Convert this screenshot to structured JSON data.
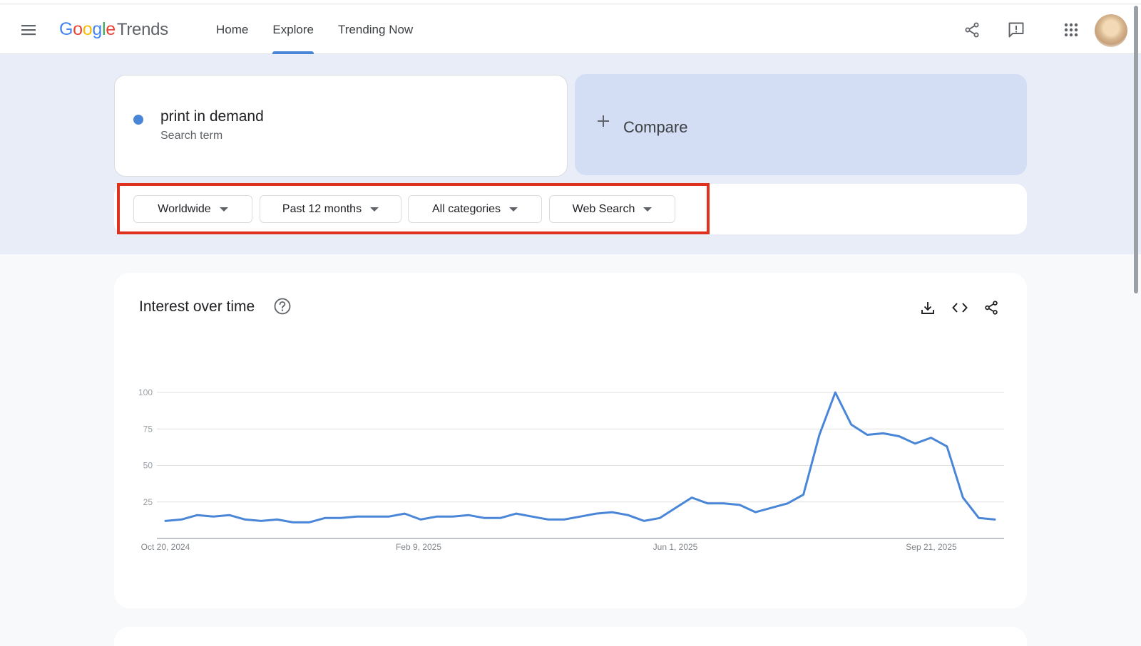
{
  "header": {
    "logo": {
      "g1": "G",
      "o1": "o",
      "o2": "o",
      "g2": "g",
      "l": "l",
      "e": "e",
      "suffix": "Trends"
    },
    "nav": [
      {
        "label": "Home",
        "active": false
      },
      {
        "label": "Explore",
        "active": true
      },
      {
        "label": "Trending Now",
        "active": false
      }
    ],
    "icons": [
      "share-icon",
      "feedback-icon",
      "apps-icon"
    ]
  },
  "search_term": {
    "term": "print in demand",
    "type": "Search term",
    "color": "#4a86d8"
  },
  "compare": {
    "label": "Compare"
  },
  "filters": [
    {
      "label": "Worldwide"
    },
    {
      "label": "Past 12 months"
    },
    {
      "label": "All categories"
    },
    {
      "label": "Web Search"
    }
  ],
  "interest": {
    "title": "Interest over time",
    "icons": [
      "help-icon",
      "download-icon",
      "embed-icon",
      "share-icon"
    ]
  },
  "chart_data": {
    "type": "line",
    "x_ticks": [
      "Oct 20, 2024",
      "Feb 9, 2025",
      "Jun 1, 2025",
      "Sep 21, 2025"
    ],
    "y_ticks": [
      "25",
      "50",
      "75",
      "100"
    ],
    "ylim": [
      0,
      100
    ],
    "grid": true,
    "series": [
      {
        "color": "#4a86d8",
        "values": [
          12,
          13,
          16,
          15,
          16,
          13,
          12,
          13,
          11,
          11,
          14,
          14,
          15,
          15,
          15,
          17,
          13,
          15,
          15,
          16,
          14,
          14,
          17,
          15,
          13,
          13,
          15,
          17,
          18,
          16,
          12,
          14,
          21,
          28,
          24,
          24,
          23,
          18,
          21,
          24,
          30,
          71,
          100,
          78,
          71,
          72,
          70,
          65,
          69,
          63,
          28,
          14,
          13
        ]
      }
    ]
  }
}
